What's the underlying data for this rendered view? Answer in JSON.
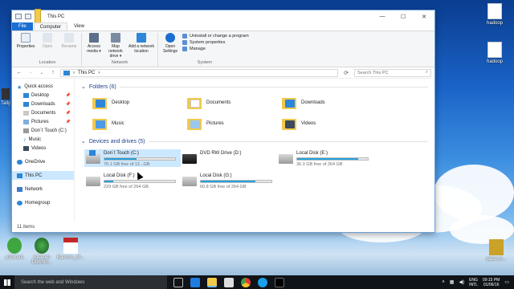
{
  "window": {
    "title": "This PC",
    "controls": {
      "minimize": "—",
      "maximize": "☐",
      "close": "✕"
    }
  },
  "ribbon": {
    "tabs": {
      "file": "File",
      "computer": "Computer",
      "view": "View"
    },
    "location": {
      "name": "Location",
      "properties": "Properties",
      "open": "Open",
      "rename": "Rename"
    },
    "network": {
      "name": "Network",
      "access_media": "Access media ▾",
      "map_drive": "Map network drive ▾",
      "add_location": "Add a network location"
    },
    "system": {
      "name": "System",
      "open_settings": "Open Settings",
      "uninstall": "Uninstall or change a program",
      "system_properties": "System properties",
      "manage": "Manage"
    }
  },
  "address": {
    "path": "This PC",
    "search_placeholder": "Search This PC"
  },
  "nav_pane": {
    "quick_access": "Quick access",
    "desktop": "Desktop",
    "downloads": "Downloads",
    "documents": "Documents",
    "pictures": "Pictures",
    "dont_touch": "Don`t Touch (C:)",
    "music": "Music",
    "videos": "Videos",
    "onedrive": "OneDrive",
    "this_pc": "This PC",
    "network": "Network",
    "homegroup": "Homegroup"
  },
  "folders": {
    "header": "Folders (6)",
    "items": [
      "Desktop",
      "Documents",
      "Downloads",
      "Music",
      "Pictures",
      "Videos"
    ]
  },
  "drives": {
    "header": "Devices and drives (5)",
    "items": [
      {
        "name": "Don`t Touch (C:)",
        "free": "70.1 GB free of 12...GB",
        "used_fraction": 0.45
      },
      {
        "name": "DVD RW Drive (D:)",
        "free": "",
        "used_fraction": 0
      },
      {
        "name": "Local Disk (E:)",
        "free": "36.3 GB free of 264 GB",
        "used_fraction": 0.86
      },
      {
        "name": "Local Disk (F:)",
        "free": "229 GB free of 264 GB",
        "used_fraction": 0.13
      },
      {
        "name": "Local Disk (G:)",
        "free": "60.8 GB free of 264 GB",
        "used_fraction": 0.77
      }
    ]
  },
  "status": {
    "items": "11 items"
  },
  "desktop": {
    "hadoop1": "hadoop",
    "hadoop2": "hadoop",
    "utorrent": "µTorrent",
    "internet_download": "Internet Downlo...",
    "barrons": "Barrons_M...",
    "tally": "Tally",
    "pace": "pace.m..."
  },
  "taskbar": {
    "search": "Search the web and Windows",
    "lang_top": "ENG",
    "lang_bottom": "INTL",
    "time": "09:15 PM",
    "date": "01/06/16"
  },
  "colors": {
    "accent": "#1a6fd1",
    "drive_bar": "#26a0da",
    "selection": "#cce8ff"
  }
}
